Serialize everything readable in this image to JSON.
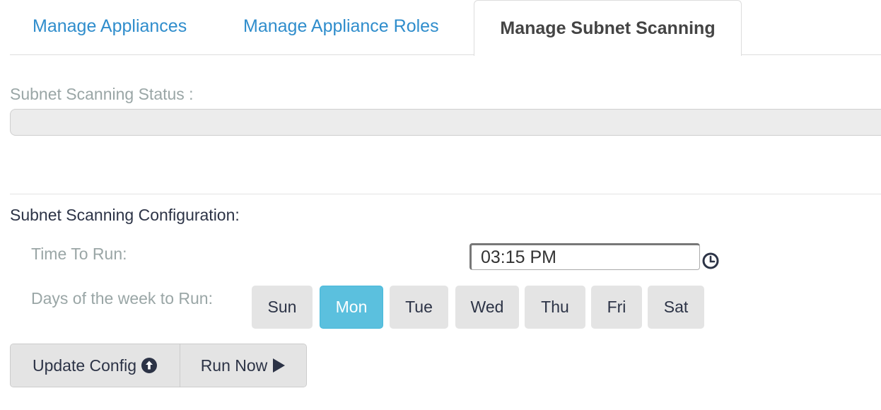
{
  "tabs": [
    {
      "label": "Manage Appliances",
      "active": false
    },
    {
      "label": "Manage Appliance Roles",
      "active": false
    },
    {
      "label": "Manage Subnet Scanning",
      "active": true
    }
  ],
  "status": {
    "label": "Subnet Scanning Status :",
    "progress_fraction": 0
  },
  "config": {
    "title": "Subnet Scanning Configuration:",
    "time_label": "Time To Run:",
    "time_value": "03:15 PM",
    "days_label": "Days of the week to Run:",
    "days": [
      {
        "label": "Sun",
        "selected": false
      },
      {
        "label": "Mon",
        "selected": true
      },
      {
        "label": "Tue",
        "selected": false
      },
      {
        "label": "Wed",
        "selected": false
      },
      {
        "label": "Thu",
        "selected": false
      },
      {
        "label": "Fri",
        "selected": false
      },
      {
        "label": "Sat",
        "selected": false
      }
    ]
  },
  "actions": {
    "update_label": "Update Config",
    "run_label": "Run Now",
    "update_icon": "circle-arrow-up-icon",
    "run_icon": "play-icon"
  },
  "colors": {
    "link": "#2f8dcc",
    "selected_day": "#5bc0de",
    "button_bg": "#e4e4e4",
    "muted_label": "#9aa6a6",
    "dark_text": "#2c3346"
  },
  "icons": {
    "clock": "clock-icon"
  }
}
